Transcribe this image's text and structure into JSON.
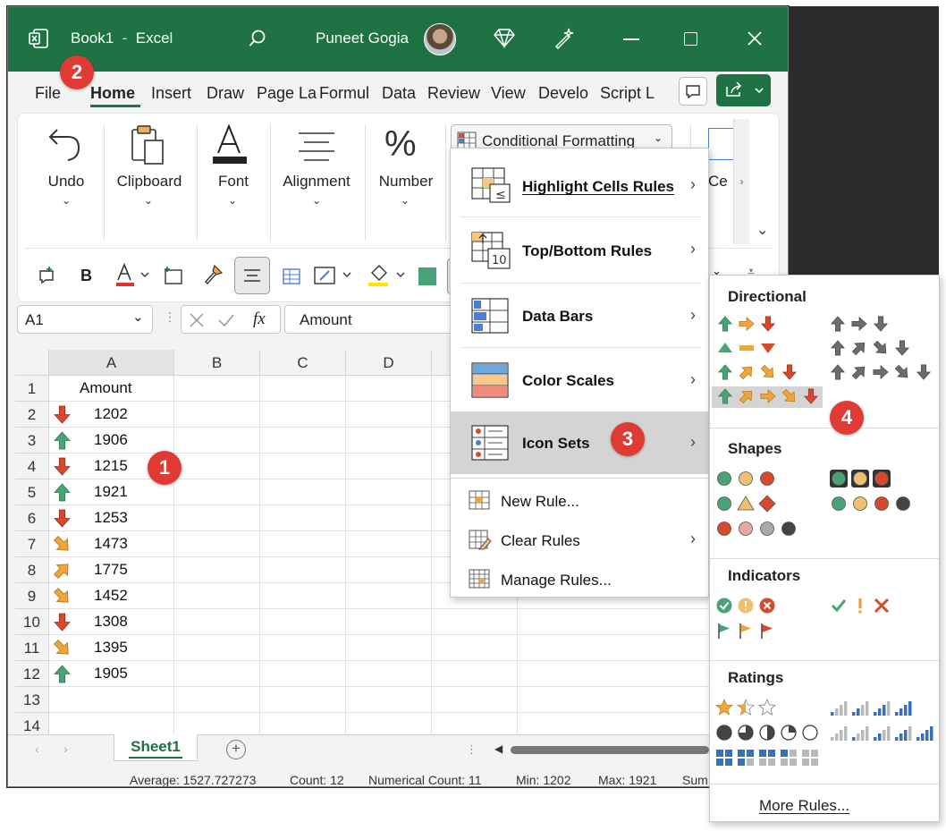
{
  "window": {
    "title": "Book1  -  Excel",
    "user": "Puneet Gogia"
  },
  "tabs": [
    "File",
    "Home",
    "Insert",
    "Draw",
    "Page La",
    "Formul",
    "Data",
    "Review",
    "View",
    "Develo",
    "Script L"
  ],
  "ribbon": {
    "undo": "Undo",
    "clipboard": "Clipboard",
    "font": "Font",
    "alignment": "Alignment",
    "number": "Number",
    "cf_button": "Conditional Formatting",
    "cells_partial": "Ce"
  },
  "formula_bar": {
    "name_box": "A1",
    "fx": "fx",
    "value": "Amount"
  },
  "columns": [
    "A",
    "B",
    "C",
    "D"
  ],
  "rows": [
    "1",
    "2",
    "3",
    "4",
    "5",
    "6",
    "7",
    "8",
    "9",
    "10",
    "11",
    "12",
    "13",
    "14"
  ],
  "header_cell": "Amount",
  "values": [
    {
      "v": "1202",
      "icon": "down"
    },
    {
      "v": "1906",
      "icon": "up"
    },
    {
      "v": "1215",
      "icon": "down"
    },
    {
      "v": "1921",
      "icon": "up"
    },
    {
      "v": "1253",
      "icon": "down"
    },
    {
      "v": "1473",
      "icon": "downright"
    },
    {
      "v": "1775",
      "icon": "upright"
    },
    {
      "v": "1452",
      "icon": "downright"
    },
    {
      "v": "1308",
      "icon": "down"
    },
    {
      "v": "1395",
      "icon": "downright"
    },
    {
      "v": "1905",
      "icon": "up"
    }
  ],
  "sheet_tab": "Sheet1",
  "status": {
    "average": "Average: 1527.727273",
    "count": "Count: 12",
    "numerical_count": "Numerical Count: 11",
    "min": "Min: 1202",
    "max": "Max: 1921",
    "sum": "Sum"
  },
  "cf_menu": {
    "highlight": "Highlight Cells Rules",
    "topbottom": "Top/Bottom Rules",
    "databars": "Data Bars",
    "colorscales": "Color Scales",
    "iconsets": "Icon Sets",
    "newrule": "New Rule...",
    "clearrules": "Clear Rules",
    "managerules": "Manage Rules..."
  },
  "icon_panel": {
    "directional": "Directional",
    "shapes": "Shapes",
    "indicators": "Indicators",
    "ratings": "Ratings",
    "more": "More Rules..."
  },
  "badges": [
    "1",
    "2",
    "3",
    "4"
  ],
  "colors": {
    "excel_green": "#1f7244",
    "up_green": "#4aa377",
    "down_red": "#d5492e",
    "mid_orange": "#f0a53c",
    "badge_red": "#e03a34"
  }
}
